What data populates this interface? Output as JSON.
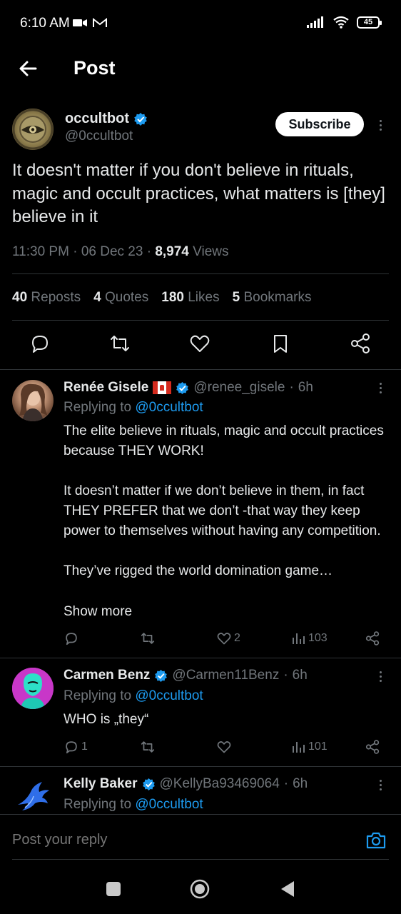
{
  "status_bar": {
    "time": "6:10 AM",
    "battery": "45"
  },
  "header": {
    "title": "Post"
  },
  "main_post": {
    "author_name": "occultbot",
    "author_handle": "@0ccultbot",
    "subscribe_label": "Subscribe",
    "text": "It doesn't matter if you don't believe in rituals, magic and occult practices, what matters is [they] believe in it",
    "time": "11:30 PM",
    "date": "06 Dec 23",
    "views_count": "8,974",
    "views_label": "Views",
    "stats": [
      {
        "count": "40",
        "label": "Reposts"
      },
      {
        "count": "4",
        "label": "Quotes"
      },
      {
        "count": "180",
        "label": "Likes"
      },
      {
        "count": "5",
        "label": "Bookmarks"
      }
    ]
  },
  "replies": [
    {
      "name": "Renée Gisele",
      "handle": "@renee_gisele",
      "time": "6h",
      "replying_prefix": "Replying to",
      "replying_to": "@0ccultbot",
      "body": "The elite believe in rituals, magic and  occult practices because THEY WORK!\n\nIt doesn’t matter if we don’t believe in them, in fact THEY PREFER that we don’t -that way they keep power to themselves without having any competition.\n\nThey’ve rigged the world domination game…",
      "show_more": "Show more",
      "likes": "2",
      "views": "103"
    },
    {
      "name": "Carmen Benz",
      "handle": "@Carmen11Benz",
      "time": "6h",
      "replying_prefix": "Replying to",
      "replying_to": "@0ccultbot",
      "body": "WHO is „they“",
      "replies": "1",
      "views": "101"
    },
    {
      "name": "Kelly Baker",
      "handle": "@KellyBa93469064",
      "time": "6h",
      "replying_prefix": "Replying to",
      "replying_to": "@0ccultbot"
    }
  ],
  "reply_box": {
    "placeholder": "Post your reply"
  },
  "colors": {
    "accent": "#1d9bf0",
    "muted": "#71767b",
    "background": "#000000"
  }
}
